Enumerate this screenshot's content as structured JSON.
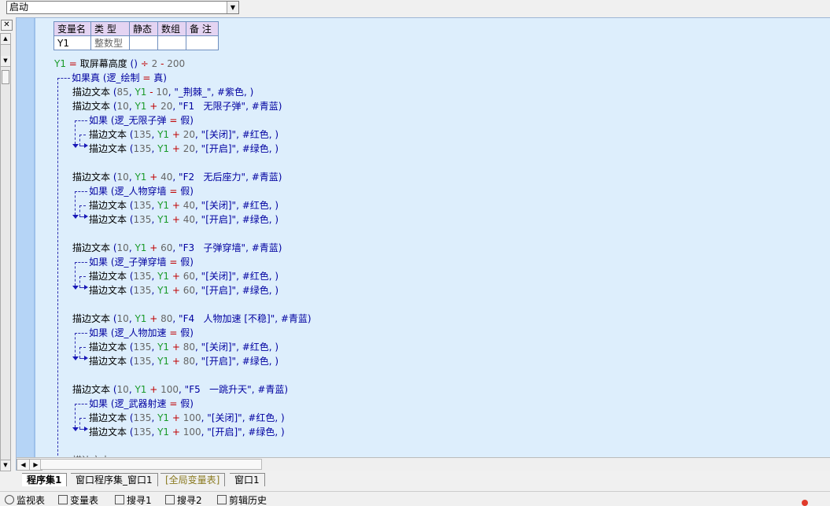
{
  "method_selector": {
    "value": "启动"
  },
  "var_table": {
    "headers": [
      "变量名",
      "类 型",
      "静态",
      "数组",
      "备 注"
    ],
    "row": [
      "Y1",
      "整数型",
      "",
      "",
      ""
    ]
  },
  "code": {
    "assign": {
      "var": "Y1",
      "eq": "=",
      "func": "取屏幕高度",
      "paren": "()",
      "div": "÷",
      "n1": "2",
      "minus": "-",
      "n2": "200"
    },
    "if_true": {
      "kw": "如果真",
      "cond": "(逻_绘制 = 真)"
    },
    "title_line": {
      "cmd": "描边文本",
      "args": "(85, Y1 - 10, \"_荆棘_\", #紫色, )"
    },
    "blocks": [
      {
        "label": "(10, Y1 + 20, \"F1   无限子弹\", #青蓝)",
        "cond": "(逻_无限子弹 = 假)",
        "off": "20",
        "lx": "(135, Y1 + 20, \"[关闭]\", #红色, )",
        "ly": "(135, Y1 + 20, \"[开启]\", #绿色, )"
      },
      {
        "label": "(10, Y1 + 40, \"F2   无后座力\", #青蓝)",
        "cond": "(逻_人物穿墙 = 假)",
        "off": "40",
        "lx": "(135, Y1 + 40, \"[关闭]\", #红色, )",
        "ly": "(135, Y1 + 40, \"[开启]\", #绿色, )"
      },
      {
        "label": "(10, Y1 + 60, \"F3   子弹穿墙\", #青蓝)",
        "cond": "(逻_子弹穿墙 = 假)",
        "off": "60",
        "lx": "(135, Y1 + 60, \"[关闭]\", #红色, )",
        "ly": "(135, Y1 + 60, \"[开启]\", #绿色, )"
      },
      {
        "label": "(10, Y1 + 80, \"F4   人物加速 [不稳]\", #青蓝)",
        "cond": "(逻_人物加速 = 假)",
        "off": "80",
        "lx": "(135, Y1 + 80, \"[关闭]\", #红色, )",
        "ly": "(135, Y1 + 80, \"[开启]\", #绿色, )"
      },
      {
        "label": "(10, Y1 + 100, \"F5   一跳升天\", #青蓝)",
        "cond": "(逻_武器射速 = 假)",
        "off": "100",
        "lx": "(135, Y1 + 100, \"[关闭]\", #红色, )",
        "ly": "(135, Y1 + 100, \"[开启]\", #绿色, )"
      }
    ],
    "cmd": "描边文本",
    "if_kw": "如果"
  },
  "tabs": [
    "程序集1",
    "窗口程序集_窗口1",
    "[全局变量表]",
    "窗口1"
  ],
  "status": [
    "监视表",
    "变量表",
    "搜寻1",
    "搜寻2",
    "剪辑历史"
  ],
  "colors": {
    "code_bg": "#ddeefc",
    "gutter": "#b5d4f6",
    "header": "#e4d4f2"
  }
}
